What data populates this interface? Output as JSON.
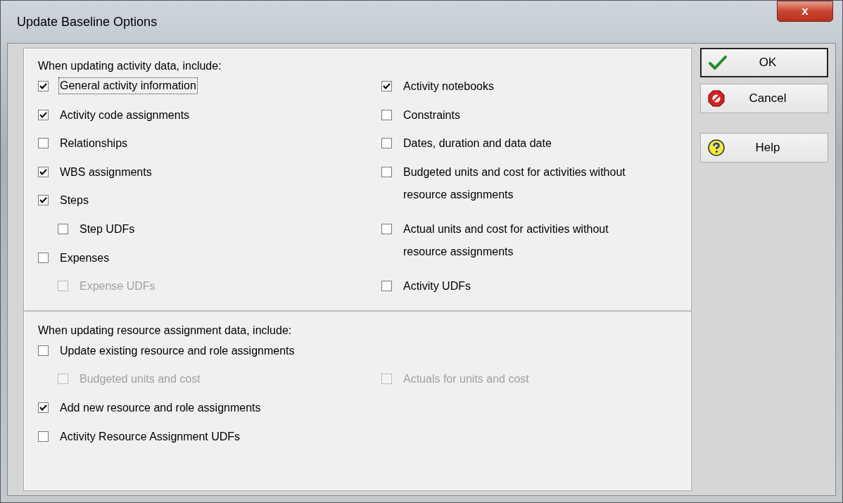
{
  "window": {
    "title": "Update Baseline Options",
    "close": "x"
  },
  "activity_section": {
    "heading": "When updating activity data, include:",
    "columns": [
      [
        {
          "label": "General activity information",
          "checked": true,
          "disabled": false,
          "focused": true
        },
        {
          "label": "Activity code assignments",
          "checked": true,
          "disabled": false,
          "focused": false
        },
        {
          "label": "Relationships",
          "checked": false,
          "disabled": false,
          "focused": false
        },
        {
          "label": "WBS assignments",
          "checked": true,
          "disabled": false,
          "focused": false
        },
        {
          "label": "Steps",
          "checked": true,
          "disabled": false,
          "focused": false,
          "children": [
            {
              "label": "Step UDFs",
              "checked": false,
              "disabled": false,
              "focused": false
            }
          ]
        },
        {
          "label": "Expenses",
          "checked": false,
          "disabled": false,
          "focused": false,
          "children": [
            {
              "label": "Expense UDFs",
              "checked": false,
              "disabled": true,
              "focused": false
            }
          ]
        }
      ],
      [
        {
          "label": "Activity notebooks",
          "checked": true,
          "disabled": false,
          "focused": false
        },
        {
          "label": "Constraints",
          "checked": false,
          "disabled": false,
          "focused": false
        },
        {
          "label": "Dates, duration and data date",
          "checked": false,
          "disabled": false,
          "focused": false
        },
        {
          "label": "Budgeted units and cost for activities without resource assignments",
          "checked": false,
          "disabled": false,
          "focused": false
        },
        {
          "label": "Actual units and cost for activities without resource assignments",
          "checked": false,
          "disabled": false,
          "focused": false
        },
        {
          "label": "Activity UDFs",
          "checked": false,
          "disabled": false,
          "focused": false
        }
      ]
    ]
  },
  "resource_section": {
    "heading": "When updating resource assignment data, include:",
    "items": [
      {
        "label": "Update existing resource and role assignments",
        "checked": false,
        "disabled": false,
        "focused": false,
        "children": [
          {
            "label": "Budgeted units and cost",
            "checked": false,
            "disabled": true,
            "focused": false
          },
          {
            "label": "Actuals for units and cost",
            "checked": false,
            "disabled": true,
            "focused": false
          }
        ]
      },
      {
        "label": "Add new resource and role assignments",
        "checked": true,
        "disabled": false,
        "focused": false
      },
      {
        "label": "Activity Resource Assignment UDFs",
        "checked": false,
        "disabled": false,
        "focused": false
      }
    ]
  },
  "buttons": [
    {
      "label": "OK",
      "kind": "ok",
      "default": true
    },
    {
      "label": "Cancel",
      "kind": "cancel",
      "default": false
    },
    {
      "label": "Help",
      "kind": "help",
      "default": false
    }
  ]
}
